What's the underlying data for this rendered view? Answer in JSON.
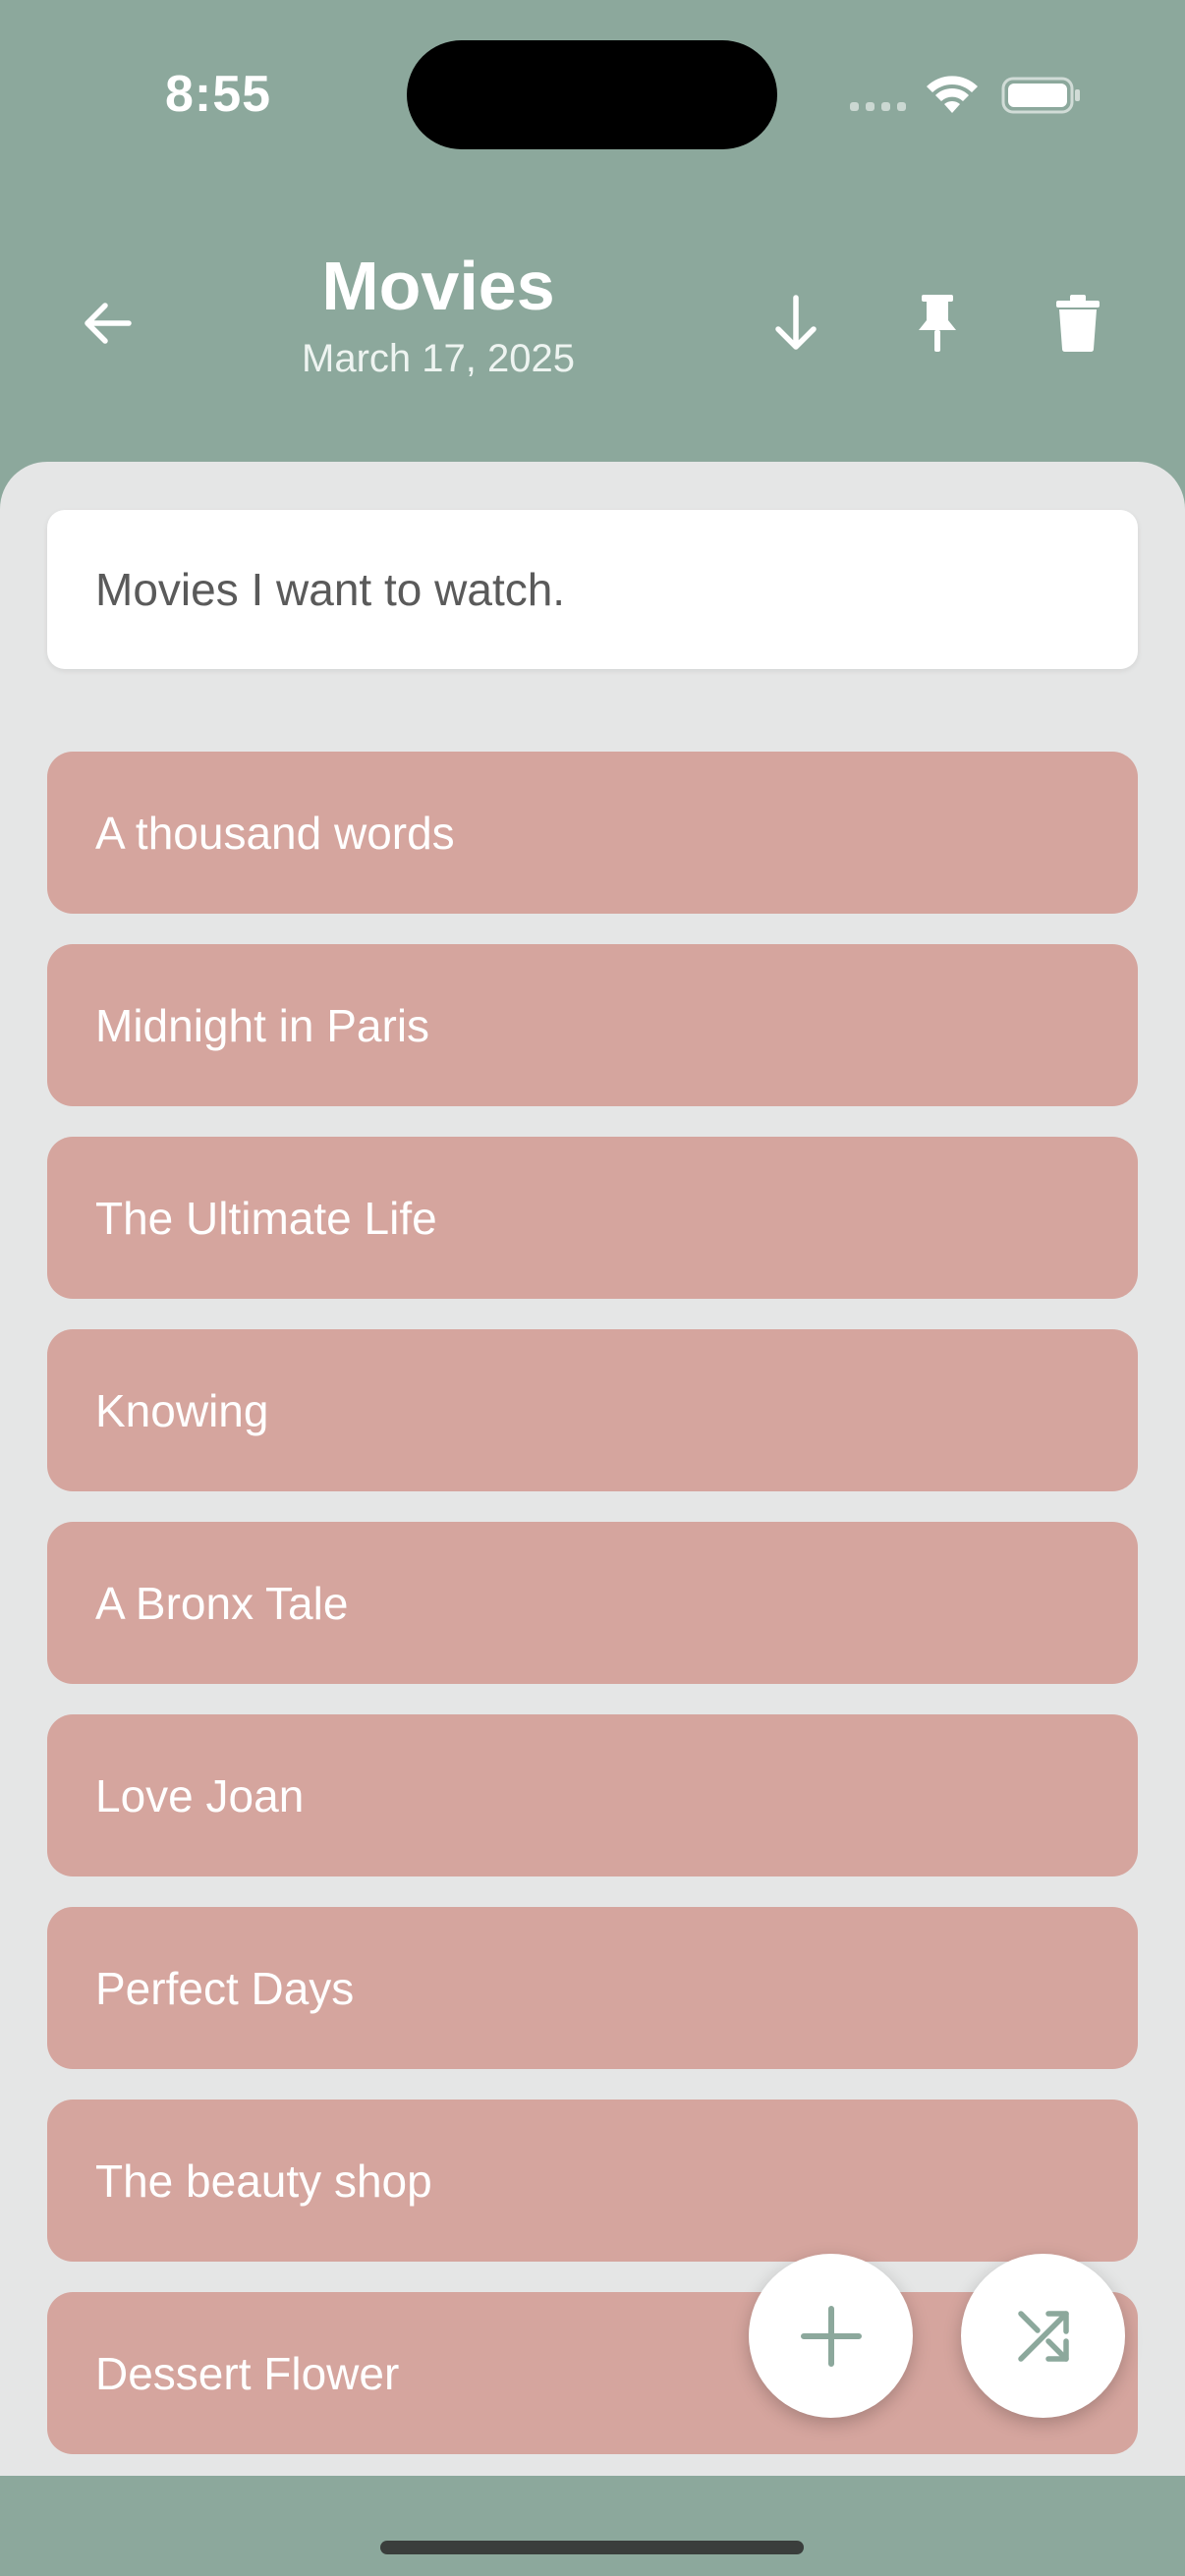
{
  "status_bar": {
    "time": "8:55"
  },
  "header": {
    "title": "Movies",
    "date": "March 17, 2025",
    "icons": {
      "back": "arrow-left-icon",
      "download": "arrow-down-icon",
      "pin": "pin-icon",
      "delete": "trash-icon"
    }
  },
  "description": "Movies I want to watch.",
  "movies": [
    "A thousand words",
    "Midnight in Paris",
    "The Ultimate Life",
    "Knowing",
    "A Bronx Tale",
    "Love Joan",
    "Perfect Days",
    "The beauty shop",
    "Dessert Flower"
  ],
  "fabs": {
    "add": "plus-icon",
    "shuffle": "shuffle-icon"
  },
  "colors": {
    "accent": "#8ca89c",
    "item": "#d5a59e",
    "panel": "#e5e6e6"
  }
}
